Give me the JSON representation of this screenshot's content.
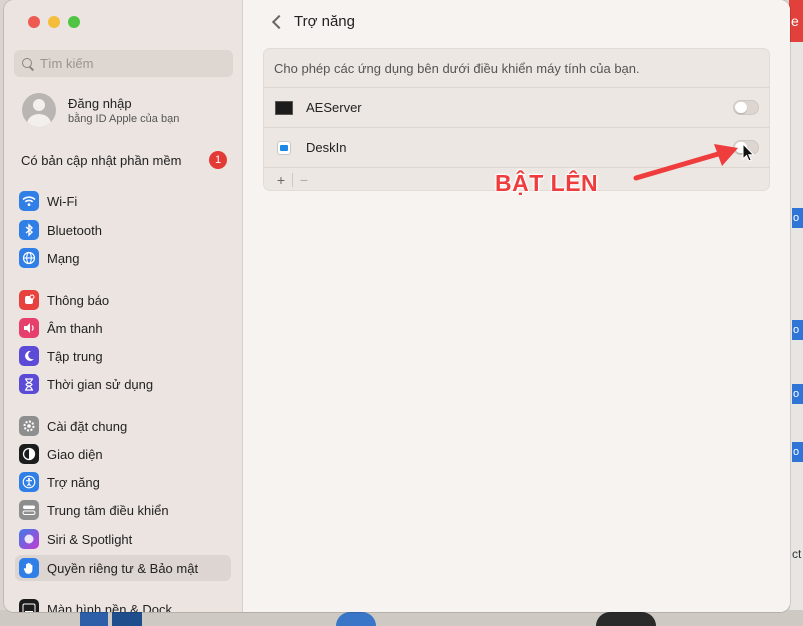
{
  "window": {
    "title": "Trợ năng"
  },
  "sidebar": {
    "search": {
      "placeholder": "Tìm kiếm"
    },
    "account": {
      "title": "Đăng nhập",
      "subtitle": "bằng ID Apple của bạn"
    },
    "update": {
      "label": "Có bản cập nhật phần mềm",
      "count": "1"
    },
    "items": [
      {
        "label": "Wi-Fi",
        "icon": "wifi-icon",
        "color": "#2f7fe6"
      },
      {
        "label": "Bluetooth",
        "icon": "bluetooth-icon",
        "color": "#2f7fe6"
      },
      {
        "label": "Mạng",
        "icon": "globe-icon",
        "color": "#2f7fe6"
      },
      {
        "label": "Thông báo",
        "icon": "bell-icon",
        "color": "#e7423e"
      },
      {
        "label": "Âm thanh",
        "icon": "speaker-icon",
        "color": "#e73f6b"
      },
      {
        "label": "Tập trung",
        "icon": "moon-icon",
        "color": "#5b4bd6"
      },
      {
        "label": "Thời gian sử dụng",
        "icon": "hourglass-icon",
        "color": "#5b4bd6"
      },
      {
        "label": "Cài đặt chung",
        "icon": "gear-icon",
        "color": "#8e8e8e"
      },
      {
        "label": "Giao diện",
        "icon": "appearance-icon",
        "color": "#1c1c1c"
      },
      {
        "label": "Trợ năng",
        "icon": "accessibility-icon",
        "color": "#2f7fe6"
      },
      {
        "label": "Trung tâm điều khiển",
        "icon": "control-center-icon",
        "color": "#8e8e8e"
      },
      {
        "label": "Siri & Spotlight",
        "icon": "siri-icon",
        "color": "#9b3fd6"
      },
      {
        "label": "Quyền riêng tư & Bảo mật",
        "icon": "hand-icon",
        "color": "#2f7fe6",
        "active": true
      },
      {
        "label": "Màn hình nền & Dock",
        "icon": "dock-icon",
        "color": "#1c1c1c"
      }
    ]
  },
  "main": {
    "description": "Cho phép các ứng dụng bên dưới điều khiển máy tính của bạn.",
    "apps": [
      {
        "name": "AEServer",
        "enabled": false
      },
      {
        "name": "DeskIn",
        "enabled": false
      }
    ],
    "add_label": "+",
    "remove_label": "−"
  },
  "annotation": {
    "text": "BẬT LÊN",
    "color": "#ef3c3c"
  },
  "background": {
    "right_edge_texts": [
      "e",
      "o",
      "o",
      "o",
      "o",
      "ct"
    ]
  }
}
